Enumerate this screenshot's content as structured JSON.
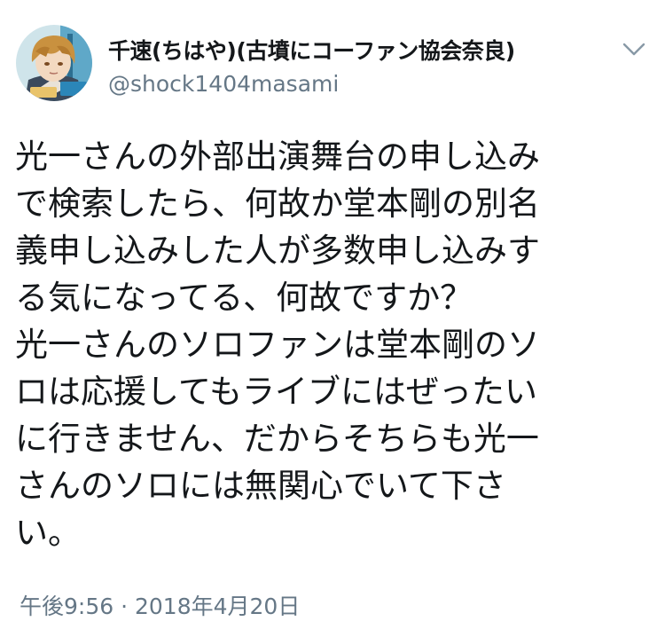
{
  "author": {
    "display_name": "千速(ちはや)(古墳にコーファン協会奈良)",
    "handle": "@shock1404masami",
    "avatar_icon": "user-avatar"
  },
  "menu": {
    "icon": "chevron-down-icon"
  },
  "tweet": {
    "lines": [
      "光一さんの外部出演舞台の申し込み",
      "で検索したら、何故か堂本剛の別名",
      "義申し込みした人が多数申し込みす",
      "る気になってる、何故ですか？",
      "光一さんのソロファンは堂本剛のソ",
      "ロは応援してもライブにはぜったい",
      "に行きません、だからそちらも光一",
      "さんのソロには無関心でいて下さ",
      "い。"
    ],
    "timestamp": "午後9:56 · 2018年4月20日"
  },
  "colors": {
    "text": "#14171a",
    "secondary": "#657786",
    "background": "#ffffff"
  }
}
